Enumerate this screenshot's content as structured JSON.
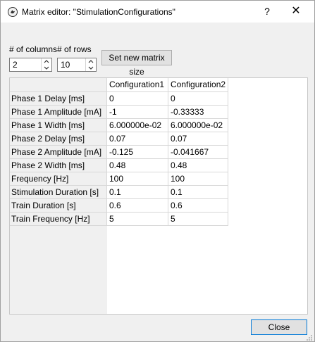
{
  "window": {
    "title": "Matrix editor: \"StimulationConfigurations\"",
    "help_label": "?",
    "close_label": "✕"
  },
  "controls": {
    "columns_label": "# of columns",
    "rows_label": "# of rows",
    "columns_value": "2",
    "rows_value": "10",
    "set_size_label": "Set new matrix size"
  },
  "table": {
    "columns": [
      "Configuration1",
      "Configuration2"
    ],
    "rows": [
      {
        "label": "Phase 1 Delay [ms]",
        "values": [
          "0",
          "0"
        ]
      },
      {
        "label": "Phase 1 Amplitude [mA]",
        "values": [
          "-1",
          "-0.33333"
        ]
      },
      {
        "label": "Phase 1 Width [ms]",
        "values": [
          "6.000000e-02",
          "6.000000e-02"
        ]
      },
      {
        "label": "Phase 2 Delay [ms]",
        "values": [
          "0.07",
          "0.07"
        ]
      },
      {
        "label": "Phase 2 Amplitude [mA]",
        "values": [
          "-0.125",
          "-0.041667"
        ]
      },
      {
        "label": "Phase 2 Width [ms]",
        "values": [
          "0.48",
          "0.48"
        ]
      },
      {
        "label": "Frequency [Hz]",
        "values": [
          "100",
          "100"
        ]
      },
      {
        "label": "Stimulation Duration [s]",
        "values": [
          "0.1",
          "0.1"
        ]
      },
      {
        "label": "Train Duration [s]",
        "values": [
          "0.6",
          "0.6"
        ]
      },
      {
        "label": "Train Frequency [Hz]",
        "values": [
          "5",
          "5"
        ]
      }
    ]
  },
  "footer": {
    "close_label": "Close"
  }
}
